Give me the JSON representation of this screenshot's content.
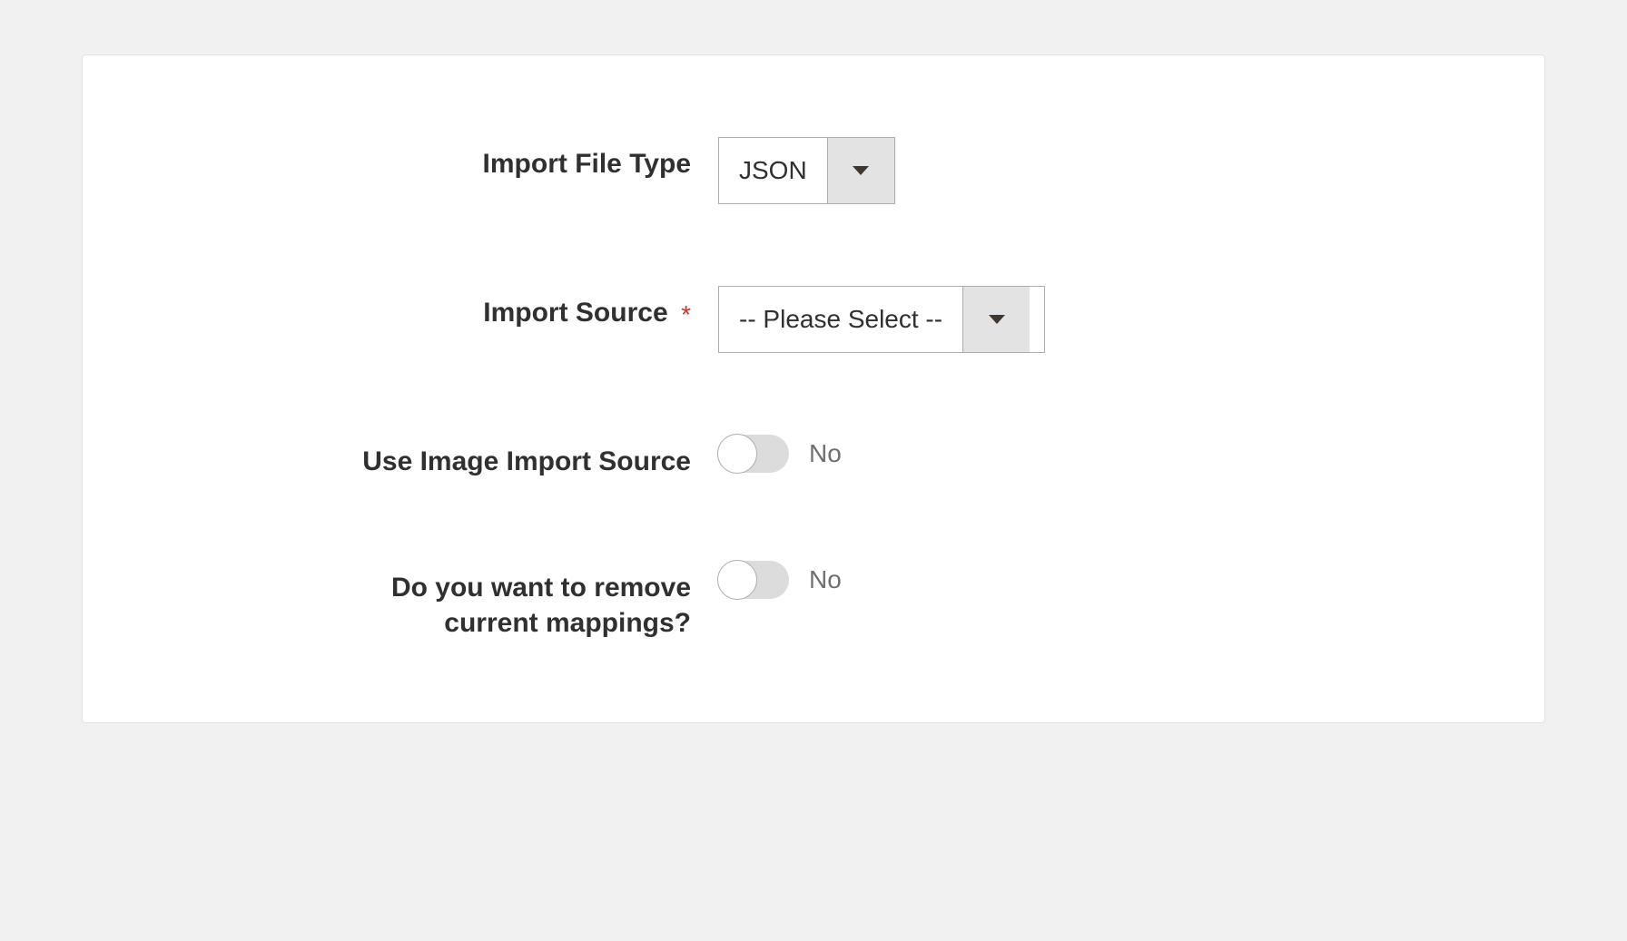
{
  "form": {
    "fields": {
      "import_file_type": {
        "label": "Import File Type",
        "required": false,
        "value": "JSON"
      },
      "import_source": {
        "label": "Import Source",
        "required": true,
        "value": "-- Please Select --"
      },
      "use_image_import_source": {
        "label": "Use Image Import Source",
        "value_label": "No"
      },
      "remove_current_mappings": {
        "label": "Do you want to remove current mappings?",
        "value_label": "No"
      }
    },
    "required_mark": "*"
  }
}
